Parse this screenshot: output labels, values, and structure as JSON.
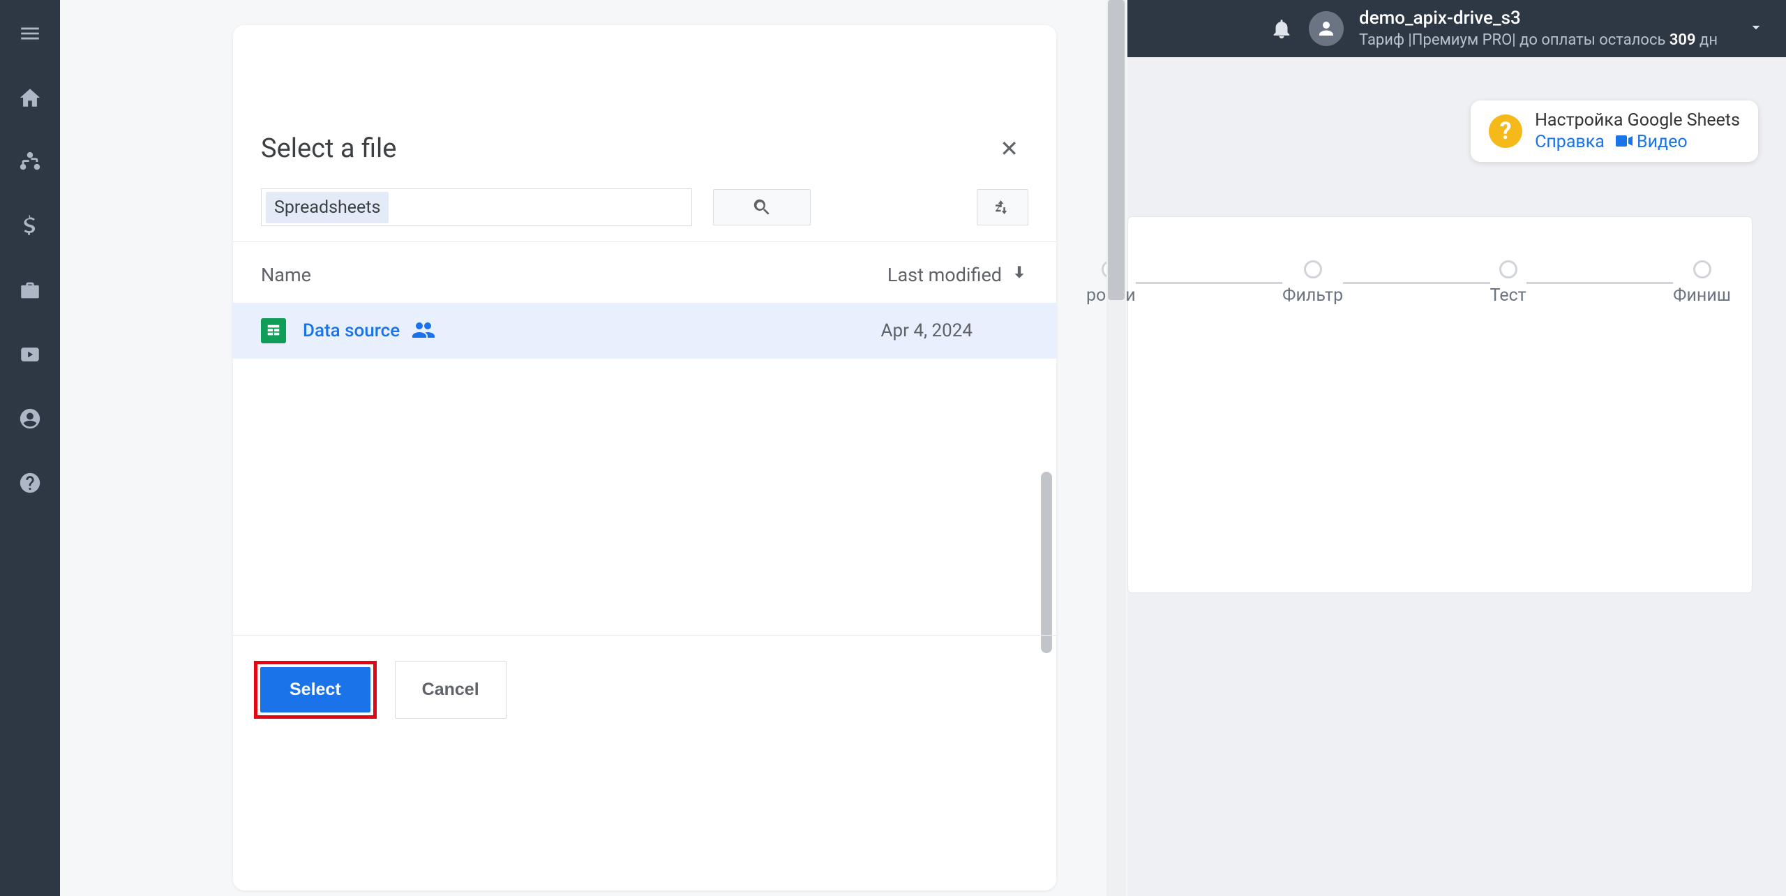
{
  "sidebar": {
    "items": [
      "menu",
      "home",
      "connections",
      "billing",
      "briefcase",
      "youtube",
      "account",
      "help"
    ]
  },
  "header": {
    "username": "demo_apix-drive_s3",
    "tariff_prefix": "Тариф |Премиум PRO| до оплаты осталось ",
    "tariff_days": "309",
    "tariff_suffix": " дн"
  },
  "help_card": {
    "title": "Настройка Google Sheets",
    "link_help": "Справка",
    "link_video": "Видео"
  },
  "stepper": {
    "steps": [
      "ройки",
      "Фильтр",
      "Тест",
      "Финиш"
    ]
  },
  "picker": {
    "title": "Select a file",
    "filter_chip": "Spreadsheets",
    "columns": {
      "name": "Name",
      "modified": "Last modified"
    },
    "files": [
      {
        "name": "Data source",
        "date": "Apr 4, 2024"
      }
    ],
    "select_btn": "Select",
    "cancel_btn": "Cancel"
  }
}
